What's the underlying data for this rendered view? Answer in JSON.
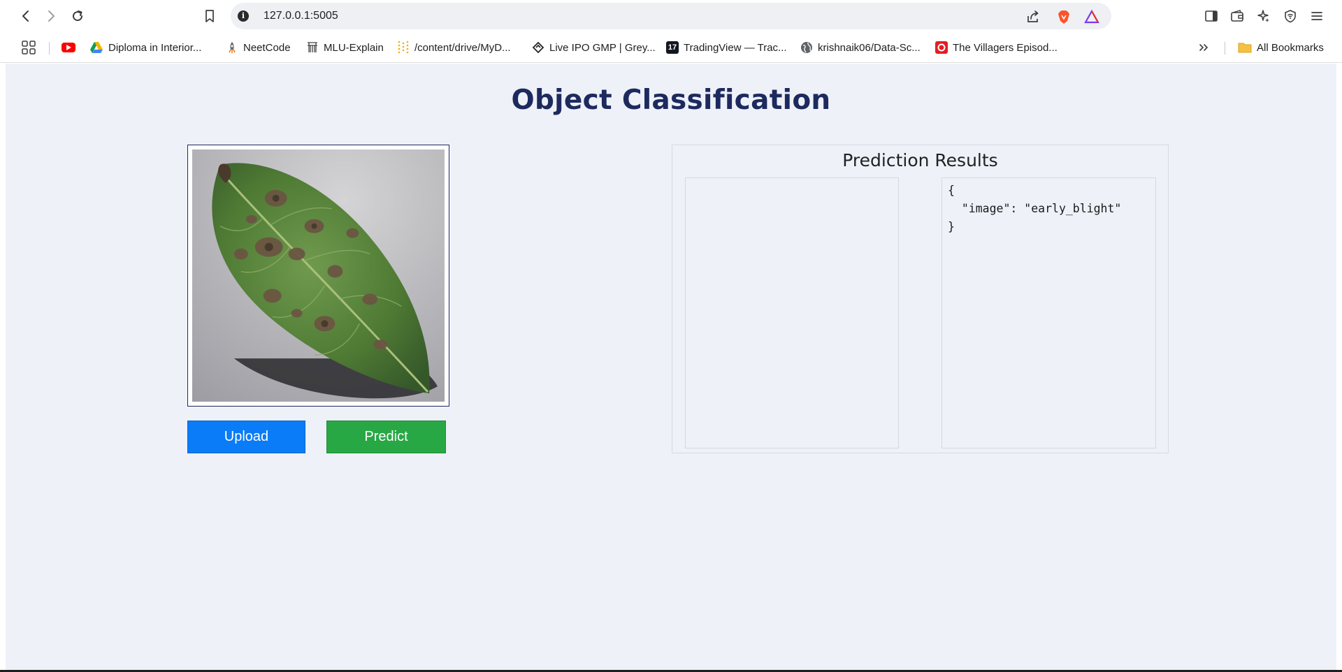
{
  "browser": {
    "url": "127.0.0.1:5005",
    "all_bookmarks_label": "All Bookmarks"
  },
  "bookmarks": [
    {
      "label": "",
      "icon": "youtube-icon",
      "color": "#ff0000"
    },
    {
      "label": "Diploma in Interior...",
      "icon": "google-drive-icon",
      "color": "#f4b400"
    },
    {
      "label": "NeetCode",
      "icon": "rocket-icon",
      "color": "#555555"
    },
    {
      "label": "MLU-Explain",
      "icon": "mlu-icon",
      "color": "#444444"
    },
    {
      "label": "/content/drive/MyD...",
      "icon": "colab-icon",
      "color": "#f9ab00"
    },
    {
      "label": "Live IPO GMP | Grey...",
      "icon": "diamond-icon",
      "color": "#222222"
    },
    {
      "label": "TradingView — Trac...",
      "icon": "tradingview-icon",
      "color": "#131722"
    },
    {
      "label": "krishnaik06/Data-Sc...",
      "icon": "globe-icon",
      "color": "#555555"
    },
    {
      "label": "The Villagers Episod...",
      "icon": "villagers-icon",
      "color": "#e31e24"
    }
  ],
  "page": {
    "title": "Object Classification",
    "upload_label": "Upload",
    "predict_label": "Predict",
    "results_title": "Prediction Results",
    "json_output": {
      "line1": "{",
      "line2": "  \"image\": \"early_blight\"",
      "line3": "}"
    }
  },
  "colors": {
    "title": "#1d2a5e",
    "upload_button": "#0a7cf8",
    "predict_button": "#28a845",
    "page_background": "#eef1f8"
  }
}
